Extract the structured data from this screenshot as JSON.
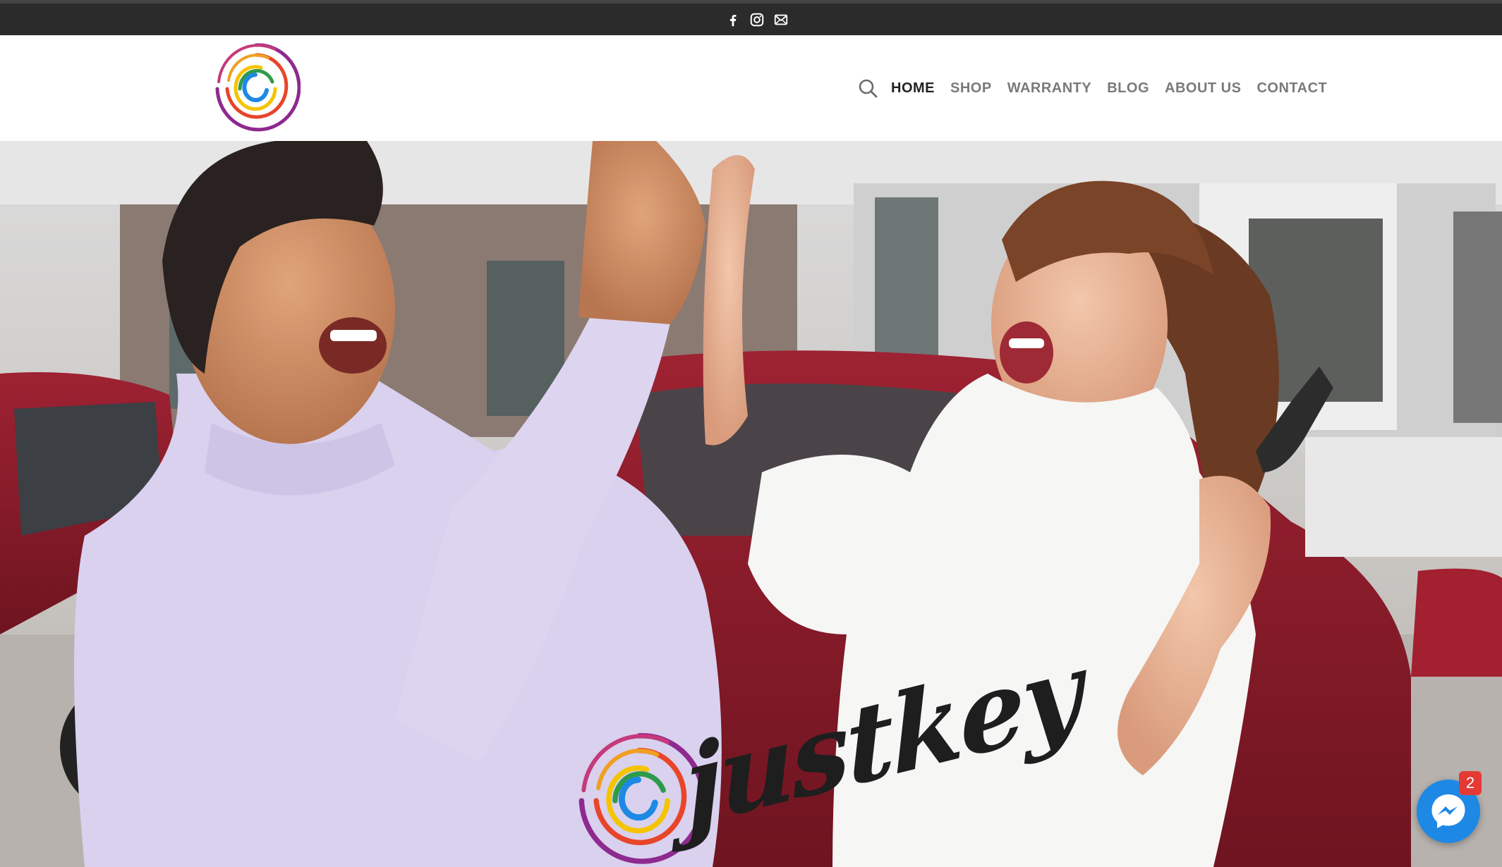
{
  "topbar": {
    "icons": [
      "facebook-icon",
      "instagram-icon",
      "envelope-icon"
    ]
  },
  "header": {
    "logo": "justkey-swirl-logo",
    "nav": {
      "search_icon": "search-icon",
      "items": [
        {
          "label": "HOME",
          "active": true
        },
        {
          "label": "SHOP",
          "active": false
        },
        {
          "label": "WARRANTY",
          "active": false
        },
        {
          "label": "BLOG",
          "active": false
        },
        {
          "label": "ABOUT US",
          "active": false
        },
        {
          "label": "CONTACT",
          "active": false
        }
      ]
    }
  },
  "hero": {
    "image": "man and woman high-five in car showroom",
    "brand_word": "justkey"
  },
  "messenger": {
    "icon": "messenger-icon",
    "badge_count": "2"
  },
  "colors": {
    "topbar": "#2b2b2b",
    "nav_text": "#7a7a7a",
    "nav_active": "#222222",
    "messenger": "#1e88e5",
    "badge": "#e53935"
  }
}
